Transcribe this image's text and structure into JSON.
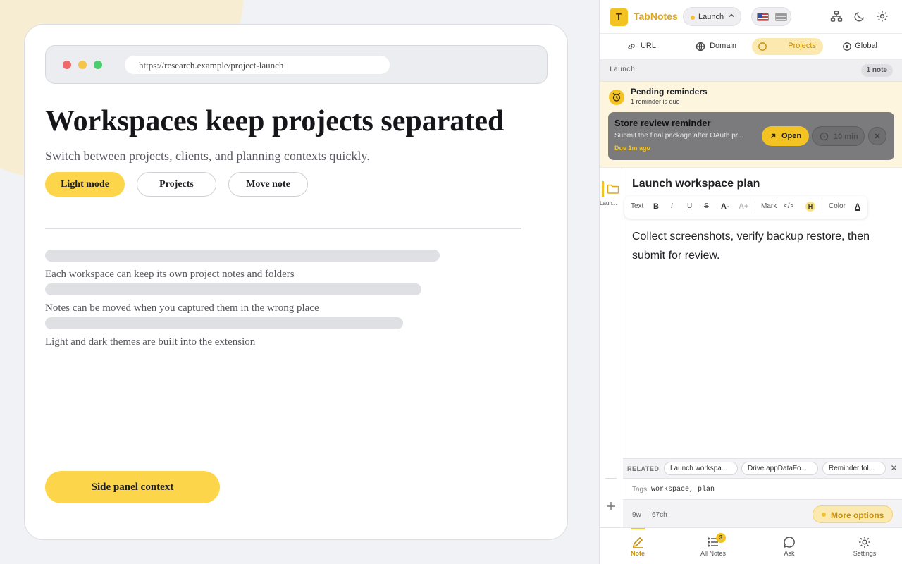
{
  "browser": {
    "url": "https://research.example/project-launch"
  },
  "page": {
    "headline": "Workspaces keep projects separated",
    "subline": "Switch between projects, clients, and planning contexts quickly.",
    "buttons": {
      "light_mode": "Light mode",
      "projects": "Projects",
      "move_note": "Move note"
    },
    "list_items": [
      "Each workspace can keep its own project notes and folders",
      "Notes can be moved when you captured them in the wrong place",
      "Light and dark themes are built into the extension"
    ],
    "cta": "Side panel context"
  },
  "panel": {
    "brand": "TabNotes",
    "logo_letter": "T",
    "workspace": "Launch",
    "scopes": [
      "URL",
      "Domain",
      "Projects",
      "Global"
    ],
    "active_scope": "Projects",
    "project_label": "Launch",
    "note_count": "1 note",
    "reminders": {
      "title": "Pending reminders",
      "subtitle": "1 reminder is due",
      "card_title": "Store review reminder",
      "card_body": "Submit the final package after OAuth pr...",
      "due": "Due 1m ago",
      "open_label": "Open",
      "snooze_label": "10 min"
    },
    "folder_label": "Laun...",
    "note": {
      "title": "Launch workspace plan",
      "body": "Collect screenshots, verify backup restore, then submit for review."
    },
    "toolbar": {
      "text": "Text",
      "bold": "B",
      "italic": "I",
      "underline": "U",
      "strike": "S",
      "size_down": "A-",
      "size_up": "A+",
      "mark": "Mark",
      "code": "</>",
      "highlight": "H",
      "color": "Color",
      "font_color": "A"
    },
    "related": {
      "label": "RELATED",
      "items": [
        "Launch workspa...",
        "Drive appDataFo...",
        "Reminder fol..."
      ]
    },
    "tags": {
      "label": "Tags",
      "value": "workspace, plan"
    },
    "meta": {
      "words": "9w",
      "chars": "67ch",
      "more_options": "More options"
    },
    "nav": {
      "items": [
        "Note",
        "All Notes",
        "Ask",
        "Settings"
      ],
      "all_notes_badge": "3"
    }
  },
  "colors": {
    "accent": "#f3c324",
    "accent_text": "#c48f0a",
    "primary_pill": "#fdd54a"
  }
}
